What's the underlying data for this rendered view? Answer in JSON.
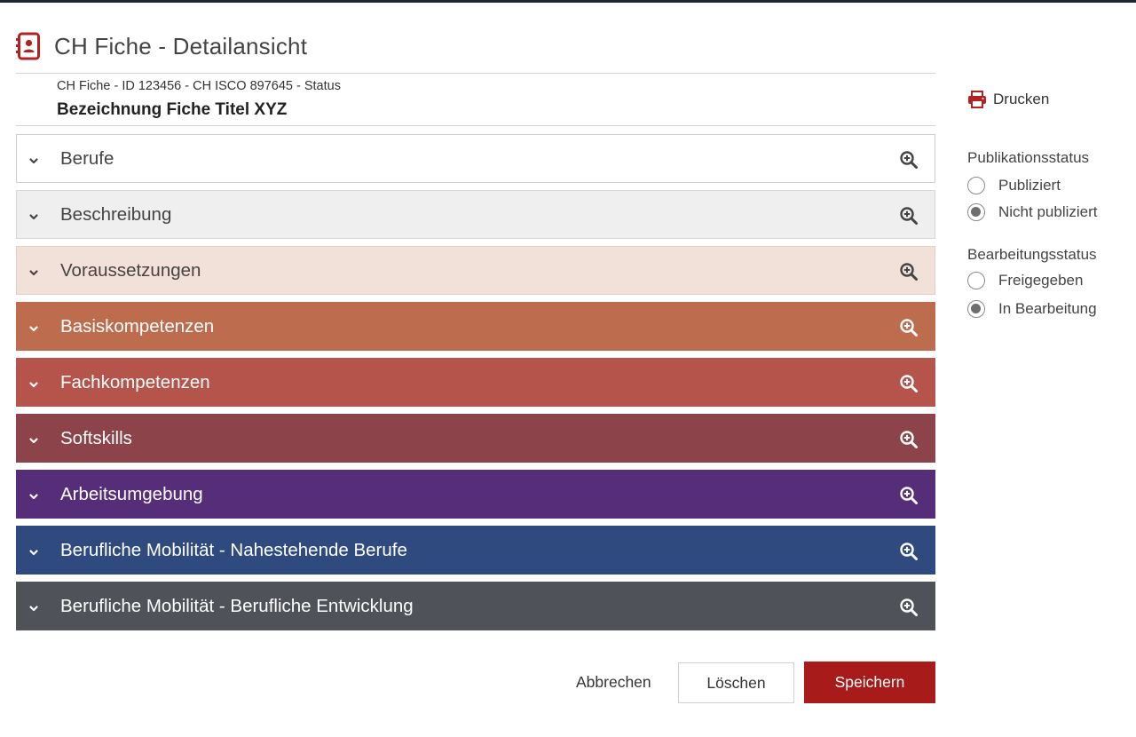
{
  "header": {
    "title": "CH Fiche - Detailansicht",
    "meta": "CH Fiche - ID 123456 - CH ISCO 897645 - Status",
    "fiche_title": "Bezeichnung Fiche Titel XYZ"
  },
  "panels": [
    {
      "label": "Berufe",
      "bg": "#ffffff",
      "border": "#cfcfcf",
      "fg": "#444444"
    },
    {
      "label": "Beschreibung",
      "bg": "#efefef",
      "border": "#d6d6d6",
      "fg": "#444444"
    },
    {
      "label": "Voraussetzungen",
      "bg": "#f2e1d9",
      "border": "#e4cfc4",
      "fg": "#444444"
    },
    {
      "label": "Basiskompetenzen",
      "bg": "#bd6d4d",
      "border": "#bd6d4d",
      "fg": "#ffffff"
    },
    {
      "label": "Fachkompetenzen",
      "bg": "#b5544a",
      "border": "#b5544a",
      "fg": "#ffffff"
    },
    {
      "label": "Softskills",
      "bg": "#8c434a",
      "border": "#8c434a",
      "fg": "#ffffff"
    },
    {
      "label": "Arbeitsumgebung",
      "bg": "#552d79",
      "border": "#552d79",
      "fg": "#ffffff"
    },
    {
      "label": "Berufliche Mobilität - Nahestehende Berufe",
      "bg": "#2f4a7e",
      "border": "#2f4a7e",
      "fg": "#ffffff"
    },
    {
      "label": "Berufliche Mobilität - Berufliche Entwicklung",
      "bg": "#4f5258",
      "border": "#4f5258",
      "fg": "#ffffff"
    }
  ],
  "aside": {
    "print_label": "Drucken",
    "publication": {
      "title": "Publikationsstatus",
      "options": [
        {
          "label": "Publiziert",
          "checked": false
        },
        {
          "label": "Nicht publiziert",
          "checked": true
        }
      ]
    },
    "editing": {
      "title": "Bearbeitungsstatus",
      "options": [
        {
          "label": "Freigegeben",
          "checked": false
        },
        {
          "label": "In Bearbeitung",
          "checked": true
        }
      ]
    }
  },
  "footer": {
    "cancel_label": "Abbrechen",
    "delete_label": "Löschen",
    "save_label": "Speichern"
  },
  "colors": {
    "accent": "#a71b1b",
    "icon_red": "#b22222"
  },
  "icons": {
    "title": "contact-card-icon",
    "print": "printer-icon",
    "panel_toggle": "chevron-down-icon",
    "panel_action": "zoom-in-icon"
  }
}
